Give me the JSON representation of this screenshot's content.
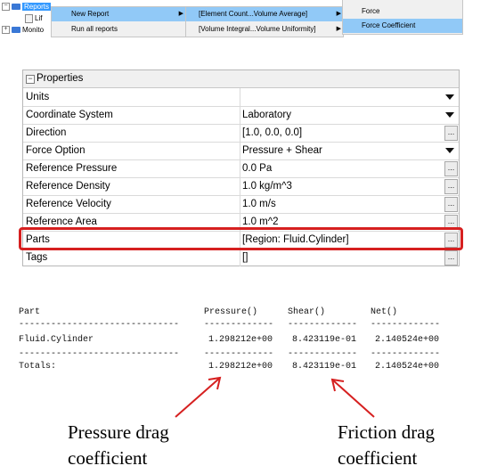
{
  "tree": {
    "items": [
      {
        "label": "Reports",
        "expander": "−"
      },
      {
        "label": "Lif"
      },
      {
        "label": "Monito",
        "expander": "+"
      }
    ]
  },
  "menu1": {
    "items": [
      "New Report",
      "Run all reports"
    ]
  },
  "menu2": {
    "items": [
      "[Element Count...Volume Average]",
      "[Volume Integral...Volume Uniformity]"
    ]
  },
  "menu3": {
    "items": [
      "Force",
      "Force Coefficient"
    ]
  },
  "properties": {
    "title": "Properties",
    "collapse_symbol": "−",
    "ellipsis": "...",
    "rows": [
      {
        "key": "Units",
        "value": ""
      },
      {
        "key": "Coordinate System",
        "value": "Laboratory"
      },
      {
        "key": "Direction",
        "value": "[1.0, 0.0, 0.0]"
      },
      {
        "key": "Force Option",
        "value": "Pressure + Shear"
      },
      {
        "key": "Reference Pressure",
        "value": "0.0 Pa"
      },
      {
        "key": "Reference Density",
        "value": "1.0 kg/m^3"
      },
      {
        "key": "Reference Velocity",
        "value": "1.0 m/s"
      },
      {
        "key": "Reference Area",
        "value": "1.0 m^2"
      },
      {
        "key": "Parts",
        "value": "[Region: Fluid.Cylinder]"
      },
      {
        "key": "Tags",
        "value": "[]"
      }
    ]
  },
  "report": {
    "headers": {
      "part": "Part",
      "pressure": "Pressure()",
      "shear": "Shear()",
      "net": "Net()"
    },
    "dash_part": "------------------------------",
    "dash_col": "-------------",
    "row": {
      "part": "Fluid.Cylinder",
      "pressure": "1.298212e+00",
      "shear": "8.423119e-01",
      "net": "2.140524e+00"
    },
    "totals": {
      "label": "Totals:",
      "pressure": "1.298212e+00",
      "shear": "8.423119e-01",
      "net": "2.140524e+00"
    }
  },
  "annotations": {
    "pressure_line1": "Pressure  drag",
    "pressure_line2": "coefficient",
    "friction_line1": "Friction  drag",
    "friction_line2": "coefficient"
  },
  "colors": {
    "highlight": "#d62020",
    "arrow": "#d62020",
    "selection": "#3399ff",
    "menu_hover": "#91c9f7"
  }
}
